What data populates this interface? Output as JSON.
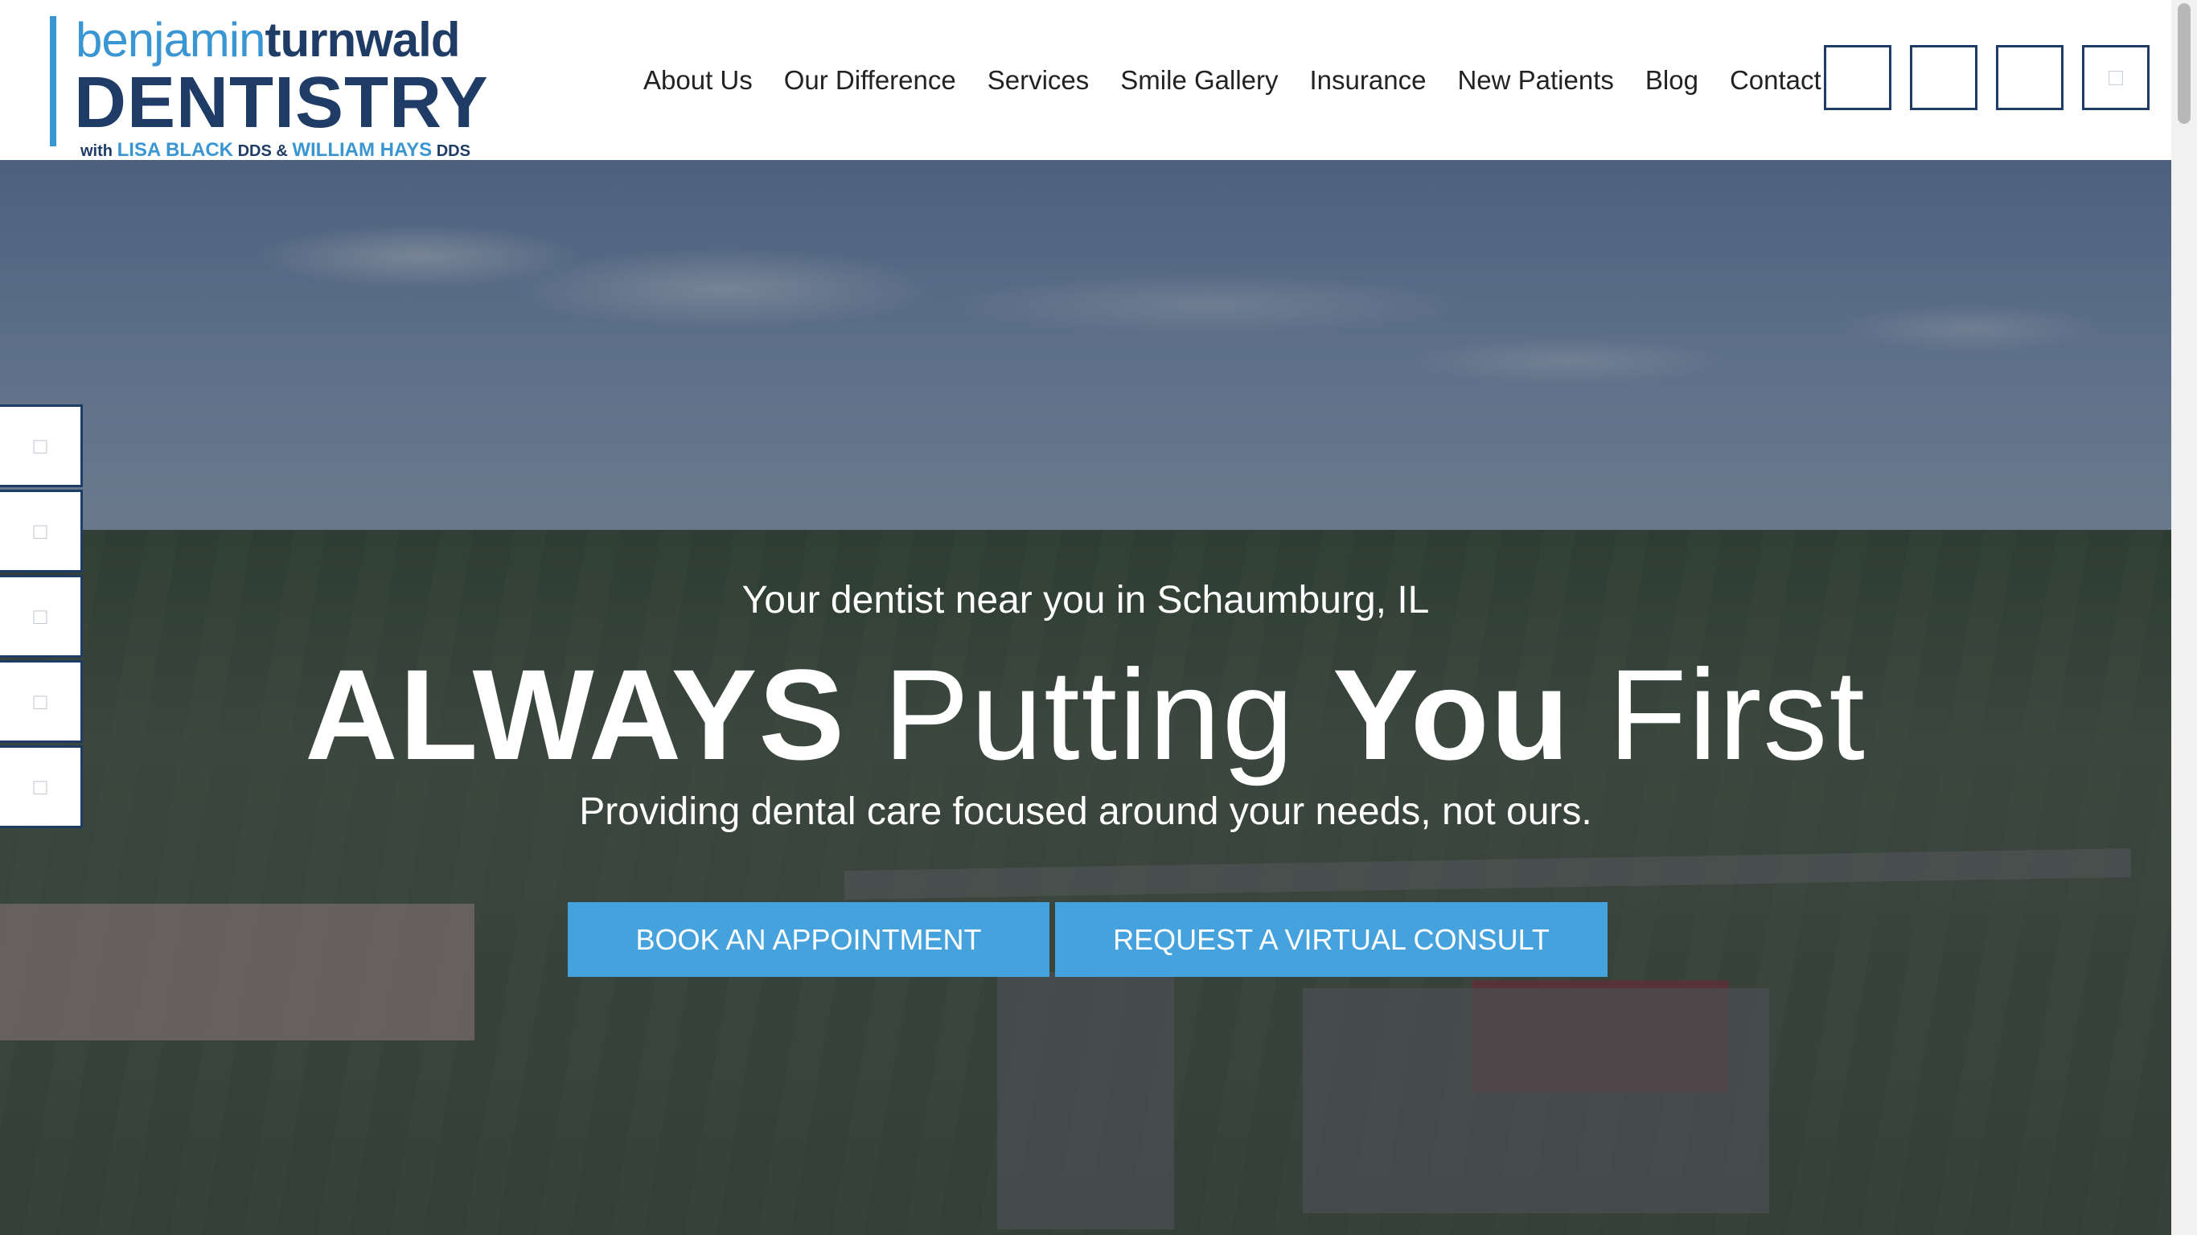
{
  "logo": {
    "light_text": "benjamin",
    "bold_text": "turnwald",
    "main_text": "DENTISTRY",
    "with_text": "with",
    "doctor1": "LISA BLACK",
    "dds1": "DDS &",
    "doctor2": "WILLIAM HAYS",
    "dds2": "DDS"
  },
  "nav": {
    "items": [
      {
        "label": "About Us"
      },
      {
        "label": "Our Difference"
      },
      {
        "label": "Services"
      },
      {
        "label": "Smile Gallery"
      },
      {
        "label": "Insurance"
      },
      {
        "label": "New Patients"
      },
      {
        "label": "Blog"
      },
      {
        "label": "Contact"
      }
    ]
  },
  "header_buttons": [
    {
      "icon": "phone-icon",
      "glyph": ""
    },
    {
      "icon": "calendar-icon",
      "glyph": ""
    },
    {
      "icon": "location-icon",
      "glyph": ""
    },
    {
      "icon": "menu-icon",
      "glyph": "□"
    }
  ],
  "hero": {
    "tagline": "Your dentist near you in Schaumburg, IL",
    "headline_1": "ALWAYS",
    "headline_2": " Putting ",
    "headline_3": "You",
    "headline_4": " First",
    "subline": "Providing dental care focused around your needs, not ours.",
    "book_label": "BOOK AN APPOINTMENT",
    "consult_label": "REQUEST A VIRTUAL CONSULT"
  },
  "side_tabs": [
    {
      "icon": "facebook-icon",
      "glyph": "□"
    },
    {
      "icon": "instagram-icon",
      "glyph": "□"
    },
    {
      "icon": "google-icon",
      "glyph": "□"
    },
    {
      "icon": "youtube-icon",
      "glyph": "□"
    },
    {
      "icon": "review-icon",
      "glyph": "□"
    }
  ],
  "colors": {
    "brand_navy": "#1f3c66",
    "brand_blue": "#3a96d2",
    "cta_blue": "#45a2dd"
  }
}
